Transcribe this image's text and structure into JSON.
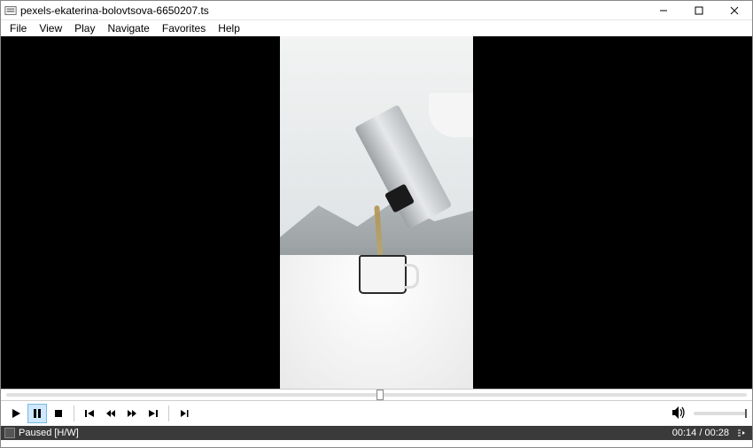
{
  "window": {
    "title": "pexels-ekaterina-bolovtsova-6650207.ts"
  },
  "menu": {
    "items": [
      "File",
      "View",
      "Play",
      "Navigate",
      "Favorites",
      "Help"
    ]
  },
  "playback": {
    "progress_percent": 50
  },
  "controls": {
    "active": "pause"
  },
  "status": {
    "text": "Paused [H/W]",
    "time_current": "00:14",
    "time_total": "00:28"
  }
}
